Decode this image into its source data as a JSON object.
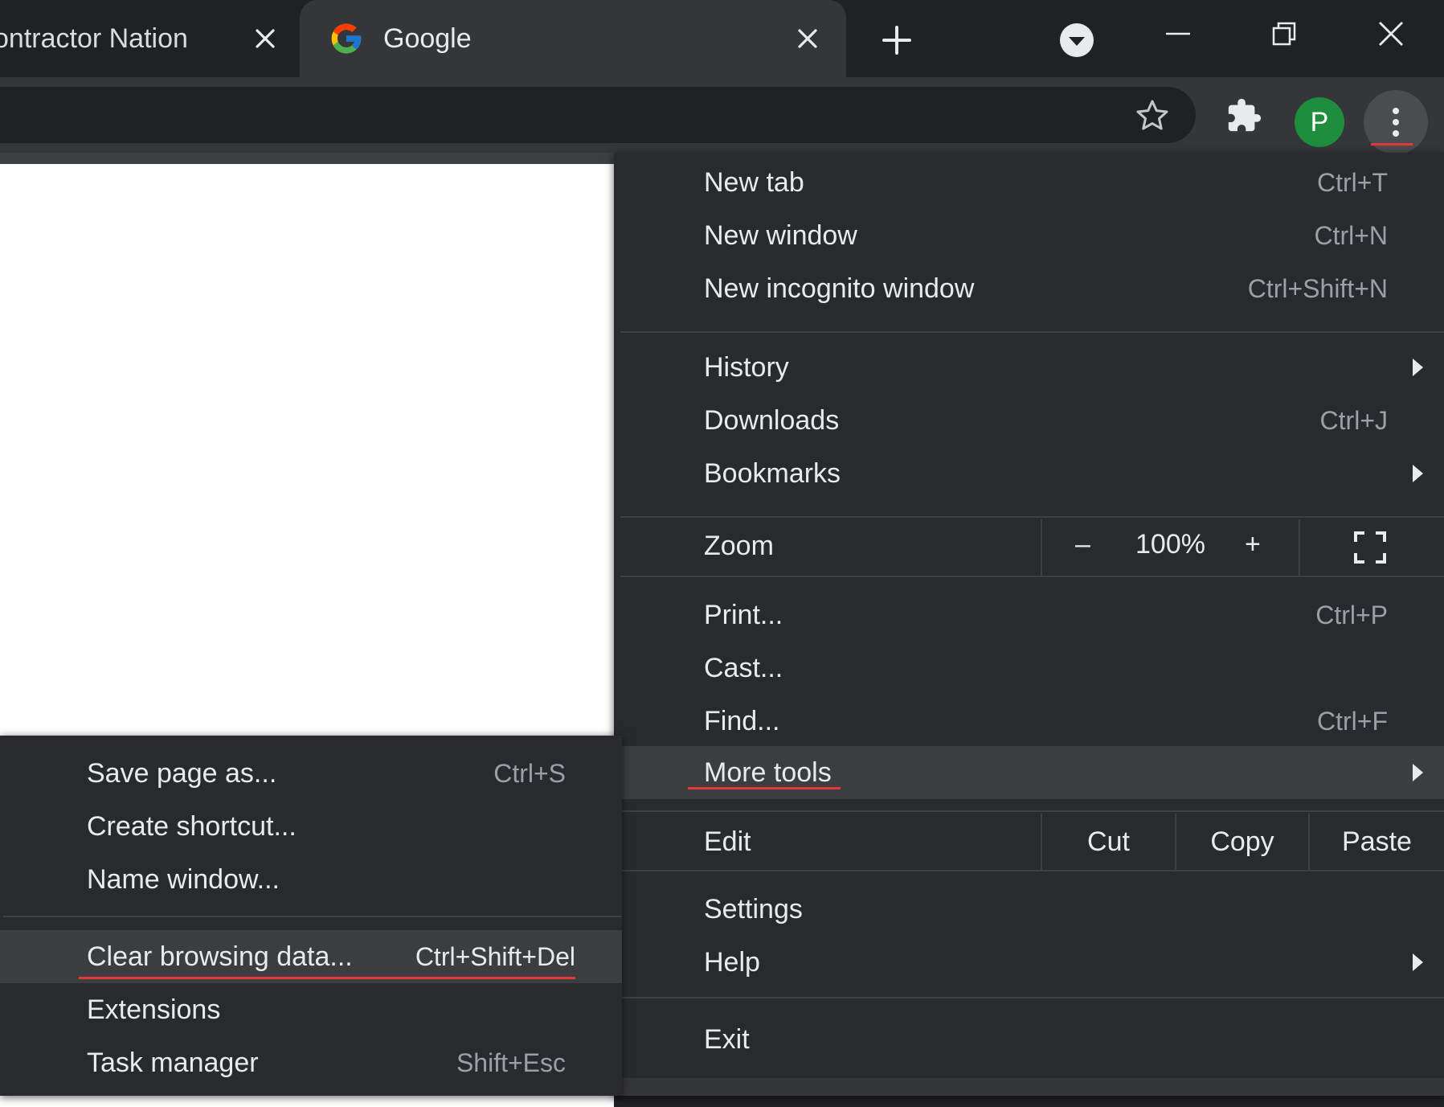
{
  "tabs": [
    {
      "title": "ontractor Nation",
      "active": false
    },
    {
      "title": "Google",
      "active": true
    }
  ],
  "icons": {
    "new_tab": "plus-icon",
    "tab_search": "tab-search-icon",
    "minimize": "minimize-icon",
    "restore": "restore-icon",
    "close": "close-icon",
    "bookmark": "star-icon",
    "extensions": "puzzle-icon",
    "menu": "kebab-menu-icon",
    "fullscreen": "fullscreen-icon"
  },
  "profile": {
    "initial": "P",
    "color": "#1e8e3e"
  },
  "main_menu": {
    "group1": [
      {
        "label": "New tab",
        "shortcut": "Ctrl+T"
      },
      {
        "label": "New window",
        "shortcut": "Ctrl+N"
      },
      {
        "label": "New incognito window",
        "shortcut": "Ctrl+Shift+N"
      }
    ],
    "group2": [
      {
        "label": "History",
        "submenu": true
      },
      {
        "label": "Downloads",
        "shortcut": "Ctrl+J"
      },
      {
        "label": "Bookmarks",
        "submenu": true
      }
    ],
    "zoom": {
      "label": "Zoom",
      "minus": "–",
      "value": "100%",
      "plus": "+"
    },
    "group3": [
      {
        "label": "Print...",
        "shortcut": "Ctrl+P"
      },
      {
        "label": "Cast..."
      },
      {
        "label": "Find...",
        "shortcut": "Ctrl+F"
      },
      {
        "label": "More tools",
        "submenu": true,
        "highlighted": true
      }
    ],
    "edit": {
      "label": "Edit",
      "cut": "Cut",
      "copy": "Copy",
      "paste": "Paste"
    },
    "group4": [
      {
        "label": "Settings"
      },
      {
        "label": "Help",
        "submenu": true
      }
    ],
    "exit": {
      "label": "Exit"
    }
  },
  "more_tools_menu": {
    "group1": [
      {
        "label": "Save page as...",
        "shortcut": "Ctrl+S"
      },
      {
        "label": "Create shortcut..."
      },
      {
        "label": "Name window..."
      }
    ],
    "group2": [
      {
        "label": "Clear browsing data...",
        "shortcut": "Ctrl+Shift+Del",
        "highlighted": true
      },
      {
        "label": "Extensions"
      },
      {
        "label": "Task manager",
        "shortcut": "Shift+Esc"
      }
    ]
  },
  "colors": {
    "annotation_underline": "#e53935",
    "menu_bg": "#292a2d",
    "highlight_bg": "#3c3d41"
  }
}
